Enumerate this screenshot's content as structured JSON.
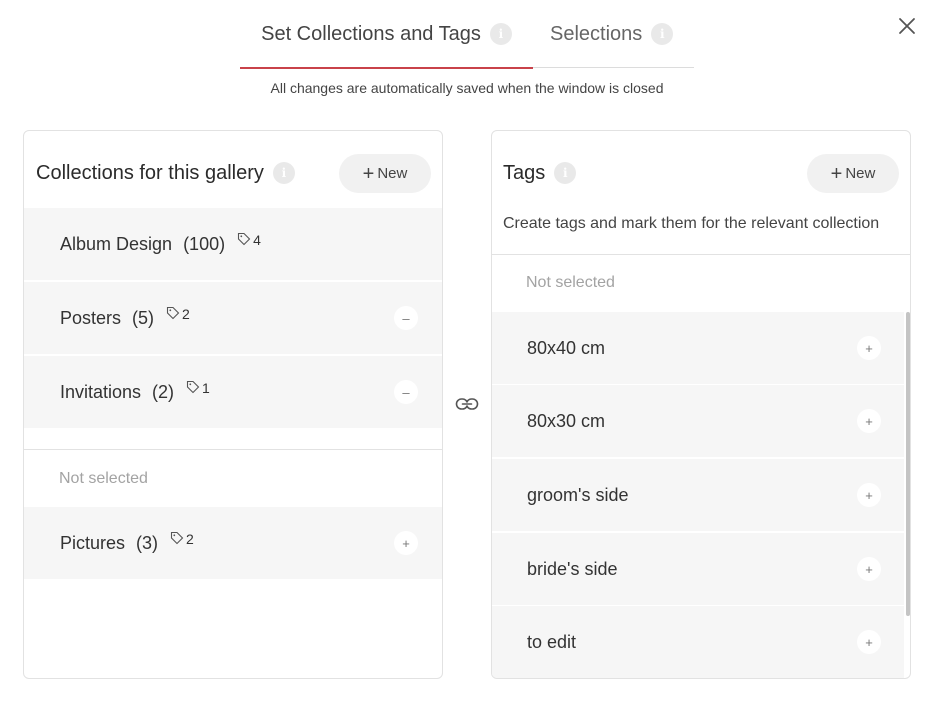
{
  "tabs": [
    {
      "label": "Set Collections and Tags",
      "info": "i"
    },
    {
      "label": "Selections",
      "info": "i"
    }
  ],
  "notice": "All changes are automatically saved when the window is closed",
  "collections": {
    "title": "Collections for this gallery",
    "info": "i",
    "new_label": "New",
    "selected": [
      {
        "name": "Album Design",
        "count": "(100)",
        "tags": "4"
      },
      {
        "name": "Posters",
        "count": "(5)",
        "tags": "2",
        "action": "–"
      },
      {
        "name": "Invitations",
        "count": "(2)",
        "tags": "1",
        "action": "–"
      }
    ],
    "not_selected_label": "Not selected",
    "not_selected": [
      {
        "name": "Pictures",
        "count": "(3)",
        "tags": "2",
        "action": "+"
      }
    ]
  },
  "tags": {
    "title": "Tags",
    "info": "i",
    "new_label": "New",
    "subtitle": "Create tags and mark them for the relevant collection",
    "not_selected_label": "Not selected",
    "items": [
      {
        "name": "80x40 cm",
        "action": "+"
      },
      {
        "name": "80x30 cm",
        "action": "+"
      },
      {
        "name": "groom's side",
        "action": "+"
      },
      {
        "name": "bride's side",
        "action": "+"
      },
      {
        "name": "to edit",
        "action": "+"
      }
    ]
  },
  "icons": {
    "close": "close-icon",
    "link": "link-icon",
    "tag": "tag-icon",
    "info": "info-icon"
  },
  "colors": {
    "accent": "#c9424a",
    "row_bg": "#f6f6f6",
    "muted": "#a3a3a3"
  }
}
